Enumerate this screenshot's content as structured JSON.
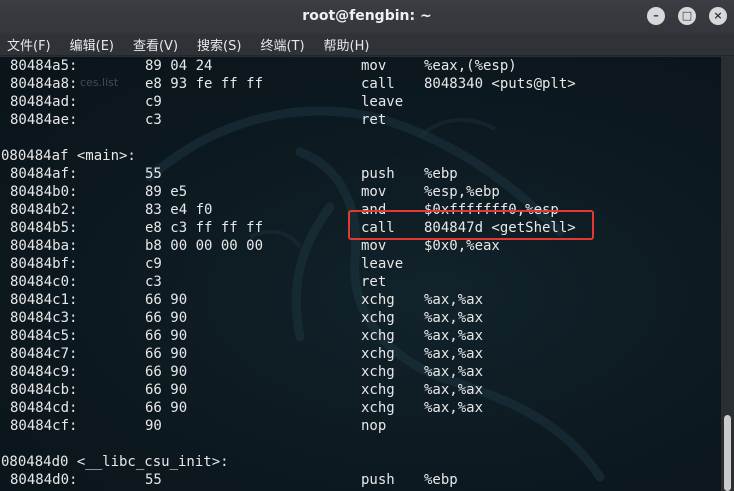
{
  "window": {
    "title": "root@fengbin: ~",
    "controls": {
      "minimize": "–",
      "maximize": "□",
      "close": "×"
    }
  },
  "menu": [
    "文件(F)",
    "编辑(E)",
    "查看(V)",
    "搜索(S)",
    "终端(T)",
    "帮助(H)"
  ],
  "ghost_text": "ces.list",
  "lines": [
    {
      "addr": "80484a5:",
      "bytes": "89 04 24",
      "mnem": "mov",
      "ops": "%eax,(%esp)"
    },
    {
      "addr": "80484a8:",
      "bytes": "e8 93 fe ff ff",
      "mnem": "call",
      "ops": "8048340 <puts@plt>"
    },
    {
      "addr": "80484ad:",
      "bytes": "c9",
      "mnem": "leave",
      "ops": ""
    },
    {
      "addr": "80484ae:",
      "bytes": "c3",
      "mnem": "ret",
      "ops": ""
    },
    {
      "blank": true
    },
    {
      "label": "080484af <main>:"
    },
    {
      "addr": "80484af:",
      "bytes": "55",
      "mnem": "push",
      "ops": "%ebp"
    },
    {
      "addr": "80484b0:",
      "bytes": "89 e5",
      "mnem": "mov",
      "ops": "%esp,%ebp"
    },
    {
      "addr": "80484b2:",
      "bytes": "83 e4 f0",
      "mnem": "and",
      "ops": "$0xfffffff0,%esp"
    },
    {
      "addr": "80484b5:",
      "bytes": "e8 c3 ff ff ff",
      "mnem": "call",
      "ops": "804847d <getShell>",
      "highlighted": true
    },
    {
      "addr": "80484ba:",
      "bytes": "b8 00 00 00 00",
      "mnem": "mov",
      "ops": "$0x0,%eax"
    },
    {
      "addr": "80484bf:",
      "bytes": "c9",
      "mnem": "leave",
      "ops": ""
    },
    {
      "addr": "80484c0:",
      "bytes": "c3",
      "mnem": "ret",
      "ops": ""
    },
    {
      "addr": "80484c1:",
      "bytes": "66 90",
      "mnem": "xchg",
      "ops": "%ax,%ax"
    },
    {
      "addr": "80484c3:",
      "bytes": "66 90",
      "mnem": "xchg",
      "ops": "%ax,%ax"
    },
    {
      "addr": "80484c5:",
      "bytes": "66 90",
      "mnem": "xchg",
      "ops": "%ax,%ax"
    },
    {
      "addr": "80484c7:",
      "bytes": "66 90",
      "mnem": "xchg",
      "ops": "%ax,%ax"
    },
    {
      "addr": "80484c9:",
      "bytes": "66 90",
      "mnem": "xchg",
      "ops": "%ax,%ax"
    },
    {
      "addr": "80484cb:",
      "bytes": "66 90",
      "mnem": "xchg",
      "ops": "%ax,%ax"
    },
    {
      "addr": "80484cd:",
      "bytes": "66 90",
      "mnem": "xchg",
      "ops": "%ax,%ax"
    },
    {
      "addr": "80484cf:",
      "bytes": "90",
      "mnem": "nop",
      "ops": ""
    },
    {
      "blank": true
    },
    {
      "label": "080484d0 <__libc_csu_init>:"
    },
    {
      "addr": "80484d0:",
      "bytes": "55",
      "mnem": "push",
      "ops": "%ebp"
    }
  ],
  "colors": {
    "terminal_background": "#0d1a21",
    "terminal_text": "#e8e8e8",
    "highlight_box": "#e23a33",
    "titlebar": "#35393d"
  }
}
